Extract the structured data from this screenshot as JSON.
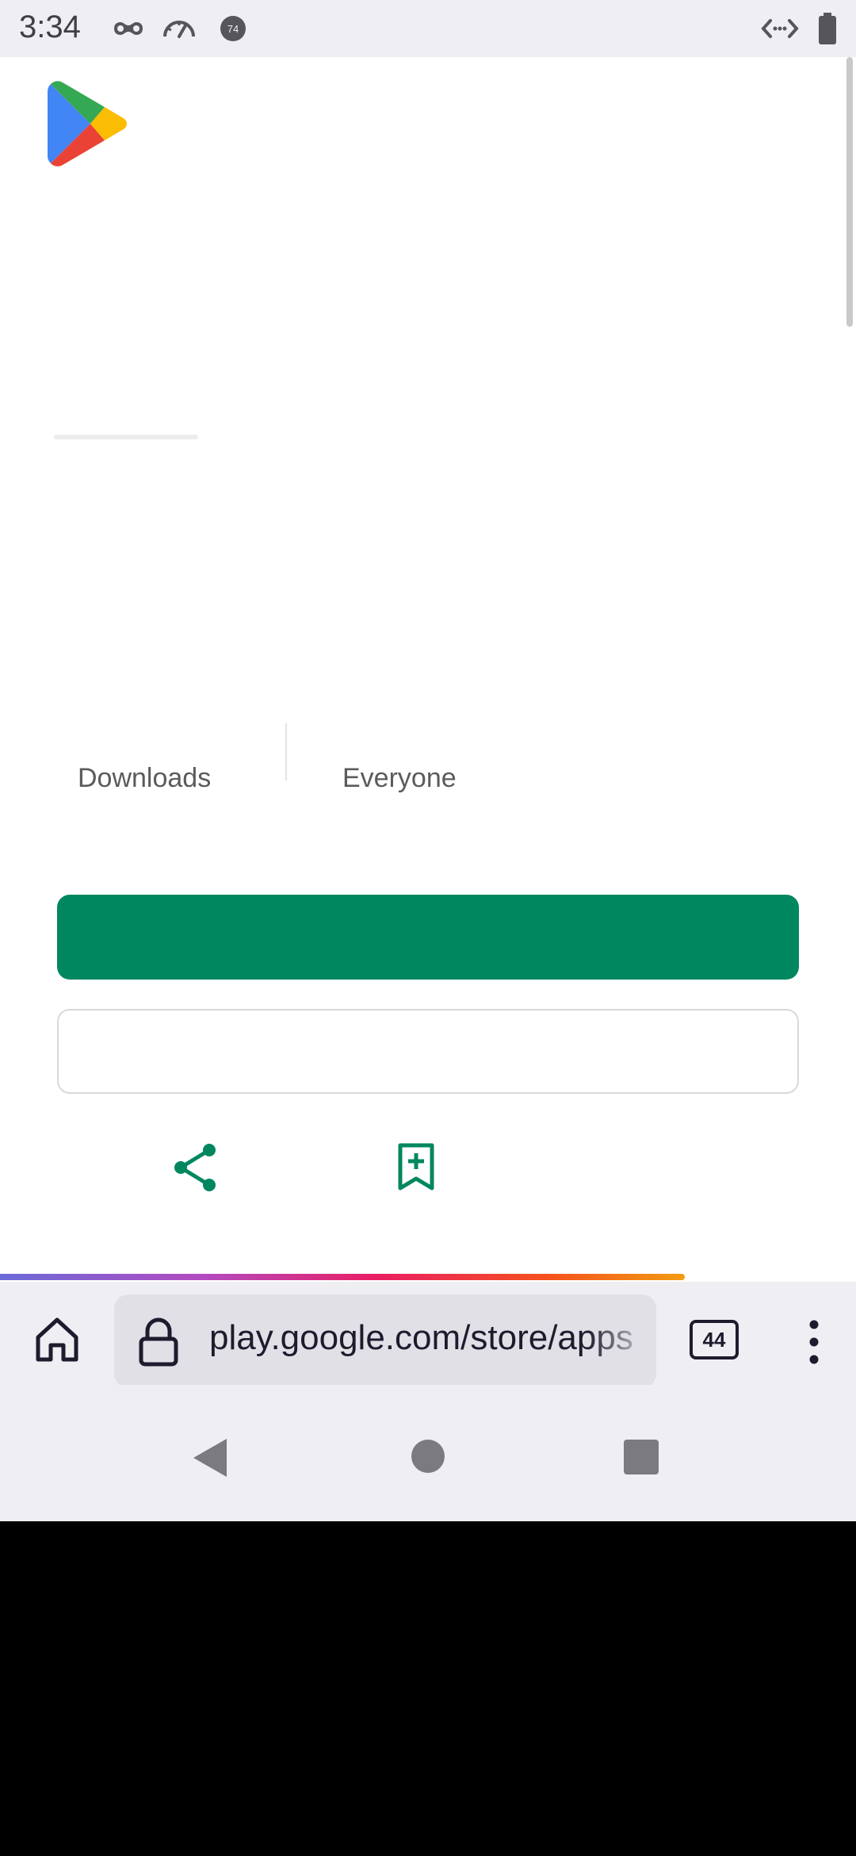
{
  "status_bar": {
    "time": "3:34",
    "icons": [
      "incognito-icon",
      "speedometer-icon",
      "notification-badge-icon",
      "code-arrows-icon",
      "battery-icon"
    ],
    "badge_number": "74"
  },
  "app_page": {
    "stats": [
      {
        "label": "Downloads"
      },
      {
        "label": "Everyone"
      }
    ],
    "accent_color": "#01875f",
    "actions": [
      "share-icon",
      "wishlist-bookmark-icon"
    ]
  },
  "browser": {
    "url": "play.google.com/store/apps",
    "tab_count": "44",
    "icons": [
      "home-icon",
      "lock-icon",
      "overflow-menu-icon"
    ],
    "load_progress": 0.8
  },
  "nav_bar": {
    "buttons": [
      "back",
      "home",
      "recents"
    ]
  }
}
